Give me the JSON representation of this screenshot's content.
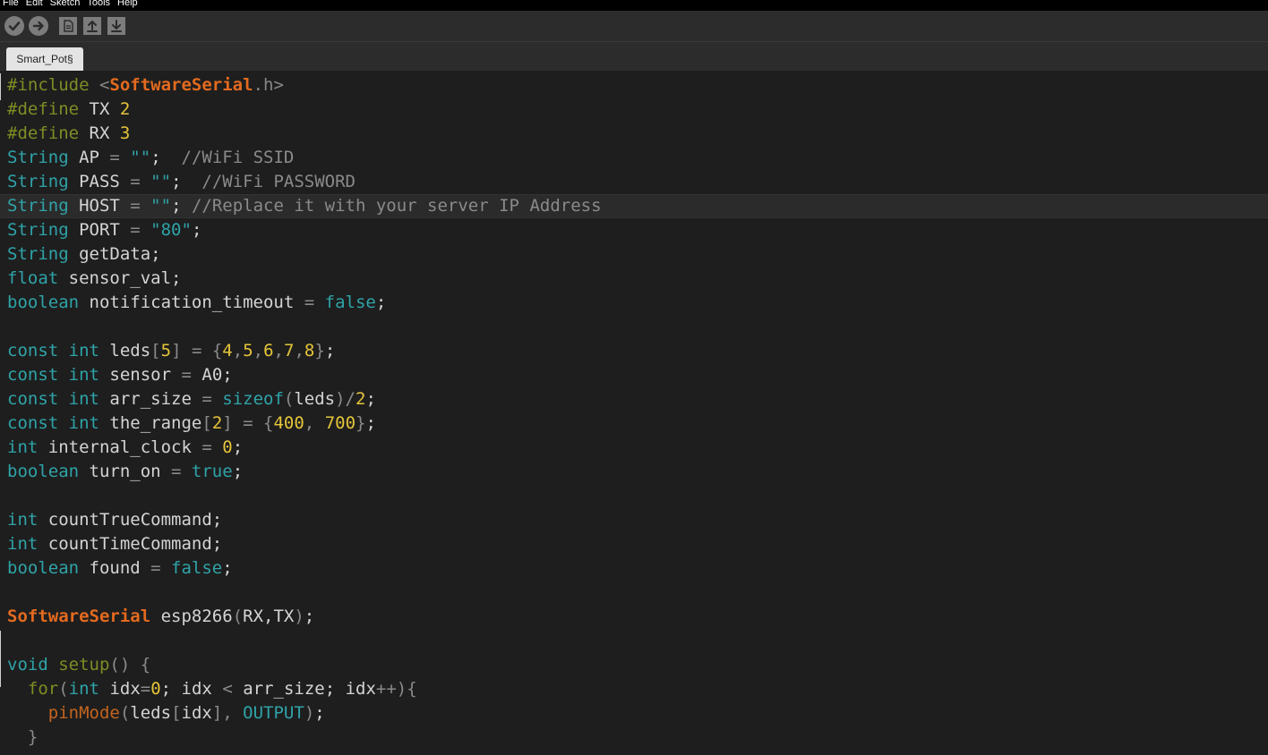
{
  "menu": [
    "File",
    "Edit",
    "Sketch",
    "Tools",
    "Help"
  ],
  "toolbar": {
    "buttons": [
      {
        "name": "verify-button",
        "icon": "checkmark-icon"
      },
      {
        "name": "upload-button",
        "icon": "right-arrow-icon"
      },
      {
        "name": "new-button",
        "icon": "document-icon"
      },
      {
        "name": "open-button",
        "icon": "up-arrow-icon"
      },
      {
        "name": "save-button",
        "icon": "down-arrow-icon"
      }
    ]
  },
  "tabs": [
    {
      "label": "Smart_Pot§"
    }
  ],
  "editor": {
    "current_line": 5,
    "lines": [
      [
        [
          "d",
          "#include "
        ],
        [
          "p",
          "<"
        ],
        [
          "b",
          "SoftwareSerial"
        ],
        [
          "p",
          ".h>"
        ]
      ],
      [
        [
          "d",
          "#define "
        ],
        [
          "t",
          "TX "
        ],
        [
          "n",
          "2"
        ]
      ],
      [
        [
          "d",
          "#define "
        ],
        [
          "t",
          "RX "
        ],
        [
          "n",
          "3"
        ]
      ],
      [
        [
          "k",
          "String "
        ],
        [
          "t",
          "AP "
        ],
        [
          "o",
          "= "
        ],
        [
          "s",
          "\"\""
        ],
        [
          "t",
          ";  "
        ],
        [
          "c",
          "//WiFi SSID"
        ]
      ],
      [
        [
          "k",
          "String "
        ],
        [
          "t",
          "PASS "
        ],
        [
          "o",
          "= "
        ],
        [
          "s",
          "\"\""
        ],
        [
          "t",
          ";  "
        ],
        [
          "c",
          "//WiFi PASSWORD"
        ]
      ],
      [
        [
          "k",
          "String "
        ],
        [
          "t",
          "HOST "
        ],
        [
          "o",
          "= "
        ],
        [
          "s",
          "\"\""
        ],
        [
          "t",
          "; "
        ],
        [
          "c",
          "//Replace it with your server IP Address"
        ]
      ],
      [
        [
          "k",
          "String "
        ],
        [
          "t",
          "PORT "
        ],
        [
          "o",
          "= "
        ],
        [
          "s",
          "\"80\""
        ],
        [
          "t",
          ";"
        ]
      ],
      [
        [
          "k",
          "String "
        ],
        [
          "t",
          "getData;"
        ]
      ],
      [
        [
          "k",
          "float "
        ],
        [
          "t",
          "sensor_val;"
        ]
      ],
      [
        [
          "k",
          "boolean "
        ],
        [
          "t",
          "notification_timeout "
        ],
        [
          "o",
          "= "
        ],
        [
          "k",
          "false"
        ],
        [
          "t",
          ";"
        ]
      ],
      [],
      [
        [
          "k",
          "const "
        ],
        [
          "k",
          "int "
        ],
        [
          "t",
          "leds"
        ],
        [
          "o",
          "["
        ],
        [
          "n",
          "5"
        ],
        [
          "o",
          "] = {"
        ],
        [
          "n",
          "4"
        ],
        [
          "o",
          ","
        ],
        [
          "n",
          "5"
        ],
        [
          "o",
          ","
        ],
        [
          "n",
          "6"
        ],
        [
          "o",
          ","
        ],
        [
          "n",
          "7"
        ],
        [
          "o",
          ","
        ],
        [
          "n",
          "8"
        ],
        [
          "o",
          "}"
        ],
        [
          "t",
          ";"
        ]
      ],
      [
        [
          "k",
          "const "
        ],
        [
          "k",
          "int "
        ],
        [
          "t",
          "sensor "
        ],
        [
          "o",
          "= "
        ],
        [
          "t",
          "A0;"
        ]
      ],
      [
        [
          "k",
          "const "
        ],
        [
          "k",
          "int "
        ],
        [
          "t",
          "arr_size "
        ],
        [
          "o",
          "= "
        ],
        [
          "k",
          "sizeof"
        ],
        [
          "o",
          "("
        ],
        [
          "t",
          "leds"
        ],
        [
          "o",
          ")/"
        ],
        [
          "n",
          "2"
        ],
        [
          "t",
          ";"
        ]
      ],
      [
        [
          "k",
          "const "
        ],
        [
          "k",
          "int "
        ],
        [
          "t",
          "the_range"
        ],
        [
          "o",
          "["
        ],
        [
          "n",
          "2"
        ],
        [
          "o",
          "] = {"
        ],
        [
          "n",
          "400"
        ],
        [
          "o",
          ", "
        ],
        [
          "n",
          "700"
        ],
        [
          "o",
          "}"
        ],
        [
          "t",
          ";"
        ]
      ],
      [
        [
          "k",
          "int "
        ],
        [
          "t",
          "internal_clock "
        ],
        [
          "o",
          "= "
        ],
        [
          "n",
          "0"
        ],
        [
          "t",
          ";"
        ]
      ],
      [
        [
          "k",
          "boolean "
        ],
        [
          "t",
          "turn_on "
        ],
        [
          "o",
          "= "
        ],
        [
          "k",
          "true"
        ],
        [
          "t",
          ";"
        ]
      ],
      [],
      [
        [
          "k",
          "int "
        ],
        [
          "t",
          "countTrueCommand;"
        ]
      ],
      [
        [
          "k",
          "int "
        ],
        [
          "t",
          "countTimeCommand;"
        ]
      ],
      [
        [
          "k",
          "boolean "
        ],
        [
          "t",
          "found "
        ],
        [
          "o",
          "= "
        ],
        [
          "k",
          "false"
        ],
        [
          "t",
          ";"
        ]
      ],
      [],
      [
        [
          "b",
          "SoftwareSerial "
        ],
        [
          "t",
          "esp8266"
        ],
        [
          "o",
          "("
        ],
        [
          "t",
          "RX,TX"
        ],
        [
          "o",
          ")"
        ],
        [
          "t",
          ";"
        ]
      ],
      [],
      [
        [
          "k",
          "void "
        ],
        [
          "d",
          "setup"
        ],
        [
          "o",
          "() {"
        ]
      ],
      [
        [
          "t",
          "  "
        ],
        [
          "d",
          "for"
        ],
        [
          "o",
          "("
        ],
        [
          "k",
          "int "
        ],
        [
          "t",
          "idx"
        ],
        [
          "o",
          "="
        ],
        [
          "n",
          "0"
        ],
        [
          "t",
          "; idx "
        ],
        [
          "o",
          "< "
        ],
        [
          "t",
          "arr_size; idx"
        ],
        [
          "o",
          "++){"
        ]
      ],
      [
        [
          "t",
          "    "
        ],
        [
          "f",
          "pinMode"
        ],
        [
          "o",
          "("
        ],
        [
          "t",
          "leds"
        ],
        [
          "o",
          "["
        ],
        [
          "t",
          "idx"
        ],
        [
          "o",
          "], "
        ],
        [
          "k",
          "OUTPUT"
        ],
        [
          "o",
          ")"
        ],
        [
          "t",
          ";"
        ]
      ],
      [
        [
          "t",
          "  "
        ],
        [
          "o",
          "}"
        ]
      ]
    ]
  }
}
